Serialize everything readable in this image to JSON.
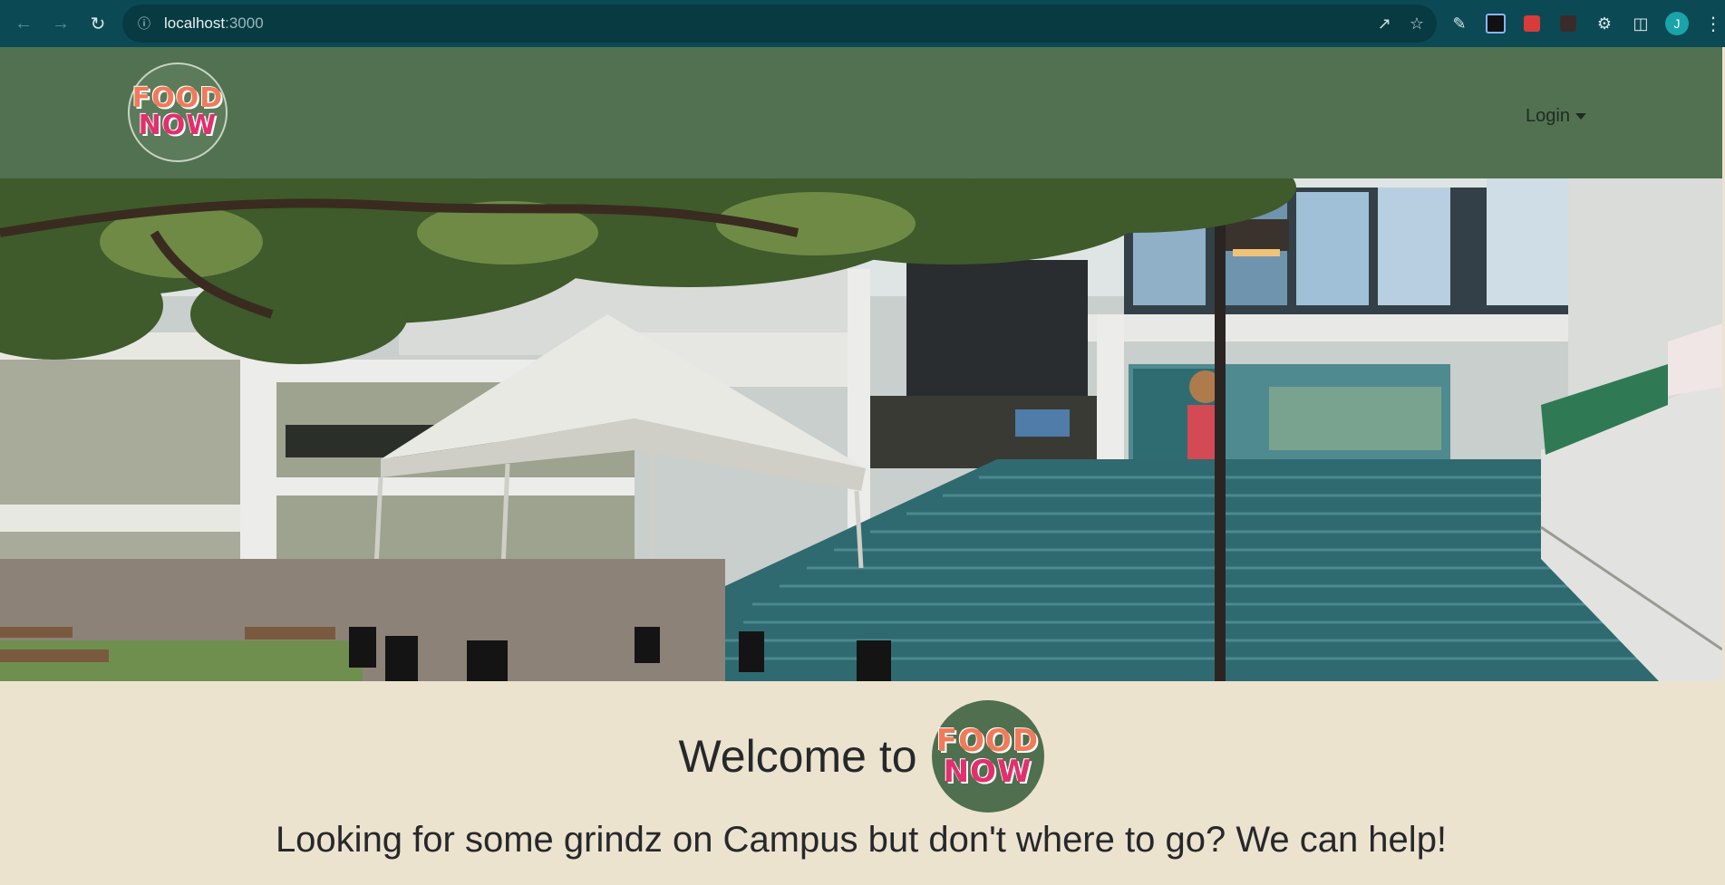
{
  "browser": {
    "url_host": "localhost",
    "url_port": ":3000",
    "avatar_letter": "J"
  },
  "navbar": {
    "logo_line1": "FOOD",
    "logo_line2": "NOW",
    "login_label": "Login"
  },
  "main": {
    "welcome_text": "Welcome to",
    "tagline": "Looking for some grindz on Campus but don't where to go? We can help!"
  },
  "colors": {
    "chrome": "#0b4a55",
    "navbar": "#527151",
    "page_background": "#ece3cf",
    "text": "#26282b"
  }
}
